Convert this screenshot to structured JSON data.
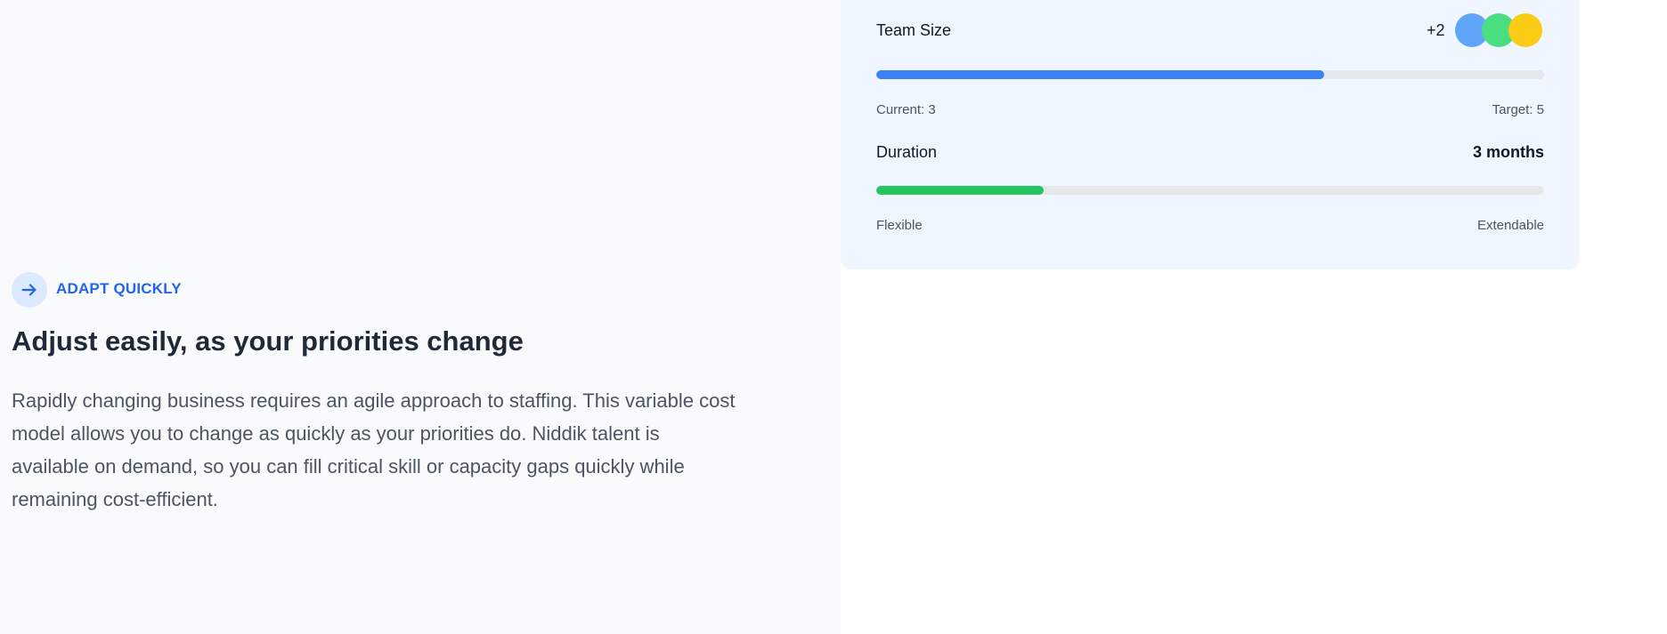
{
  "card": {
    "team_size": {
      "label": "Team Size",
      "extra_count": "+2",
      "avatar_colors": [
        "#60a5fa",
        "#4ade80",
        "#facc15"
      ],
      "progress": 0.67,
      "progress_color": "#3b82f6",
      "left_caption": "Current: 3",
      "right_caption": "Target: 5"
    },
    "duration": {
      "label": "Duration",
      "value": "3 months",
      "progress": 0.25,
      "progress_color": "#22c55e",
      "left_caption": "Flexible",
      "right_caption": "Extendable"
    }
  },
  "section": {
    "icon": "arrow-right-icon",
    "eyebrow": "ADAPT QUICKLY",
    "eyebrow_color": "#2563eb",
    "heading": "Adjust easily, as your priorities change",
    "body_lines": [
      "Rapidly changing business requires an agile approach to staffing. This variable cost",
      "model allows you to change as quickly as your priorities do. Niddik talent is",
      "available on demand, so you can fill critical skill or capacity gaps quickly while",
      "remaining cost-efficient."
    ]
  }
}
